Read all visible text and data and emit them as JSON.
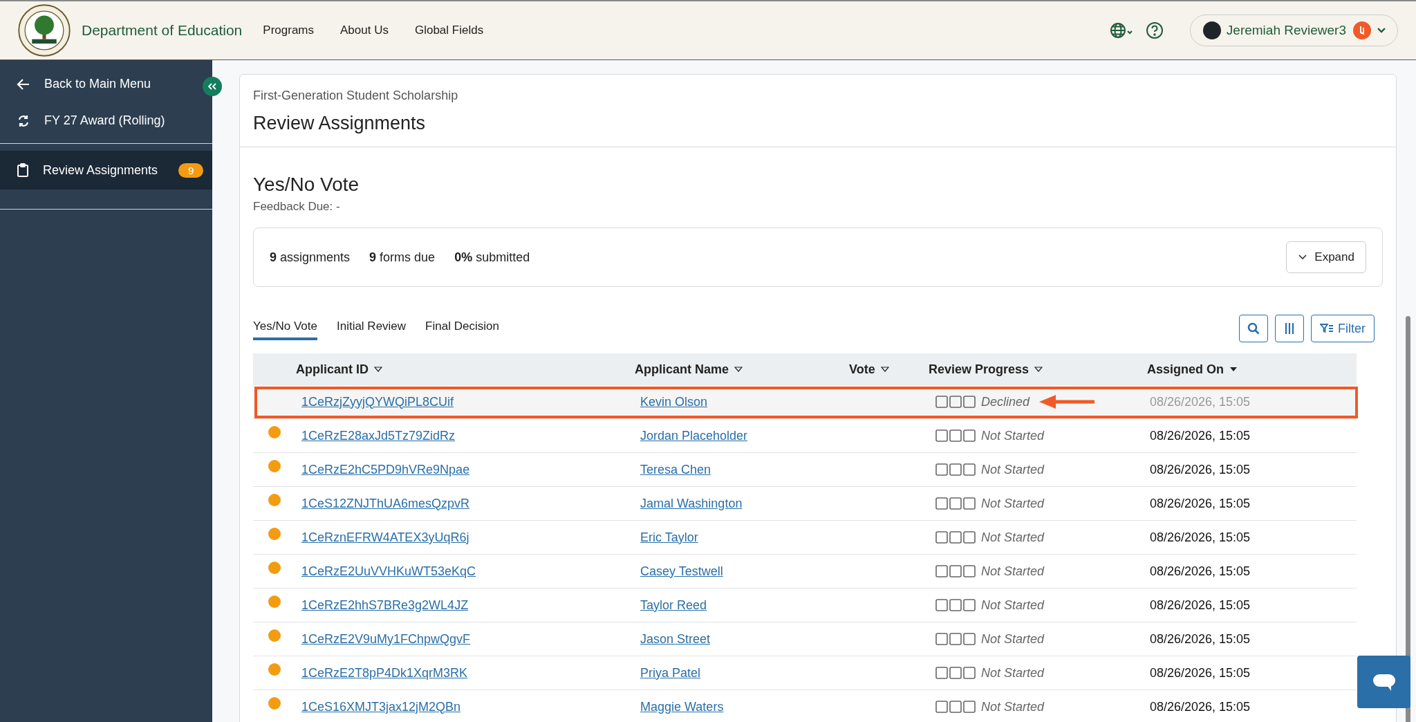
{
  "header": {
    "org_name": "Department of Education",
    "nav": [
      "Programs",
      "About Us",
      "Global Fields"
    ],
    "user_name": "Jeremiah Reviewer3"
  },
  "sidebar": {
    "items": [
      {
        "label": "Back to Main Menu",
        "kind": "back",
        "selected": false
      },
      {
        "label": "FY 27 Award (Rolling)",
        "kind": "cycle",
        "selected": false
      },
      {
        "label": "Review Assignments",
        "kind": "clipboard",
        "selected": true,
        "badge": "9"
      }
    ]
  },
  "page": {
    "program": "First-Generation Student Scholarship",
    "title": "Review Assignments"
  },
  "stage": {
    "title": "Yes/No Vote",
    "feedback_due": "Feedback Due: -",
    "stats": [
      "**9** assignments",
      "**9** forms due",
      "**0%** submitted"
    ],
    "expand_button": "Expand"
  },
  "tabs": [
    {
      "label": "Yes/No Vote",
      "selected": true
    },
    {
      "label": "Initial Review",
      "selected": false
    },
    {
      "label": "Final Decision",
      "selected": false
    }
  ],
  "filter_button": "Filter",
  "table": {
    "columns": [
      {
        "label": "Applicant ID",
        "sorted": false
      },
      {
        "label": "Applicant Name",
        "sorted": false
      },
      {
        "label": "Vote",
        "sorted": false
      },
      {
        "label": "Review Progress",
        "sorted": false
      },
      {
        "label": "Assigned On",
        "sorted": true
      }
    ],
    "rows": [
      {
        "dot": false,
        "highlighted": true,
        "id": "1CeRzjZyyjQYWQiPL8CUif",
        "name": "Kevin Olson",
        "status": "Declined",
        "assigned": "08/26/2026, 15:05"
      },
      {
        "dot": true,
        "highlighted": false,
        "id": "1CeRzE28axJd5Tz79ZidRz",
        "name": "Jordan Placeholder",
        "status": "Not Started",
        "assigned": "08/26/2026, 15:05"
      },
      {
        "dot": true,
        "highlighted": false,
        "id": "1CeRzE2hC5PD9hVRe9Npae",
        "name": "Teresa Chen",
        "status": "Not Started",
        "assigned": "08/26/2026, 15:05"
      },
      {
        "dot": true,
        "highlighted": false,
        "id": "1CeS12ZNJThUA6mesQzpvR",
        "name": "Jamal Washington",
        "status": "Not Started",
        "assigned": "08/26/2026, 15:05"
      },
      {
        "dot": true,
        "highlighted": false,
        "id": "1CeRznEFRW4ATEX3yUqR6j",
        "name": "Eric Taylor",
        "status": "Not Started",
        "assigned": "08/26/2026, 15:05"
      },
      {
        "dot": true,
        "highlighted": false,
        "id": "1CeRzE2UuVVHKuWT53eKqC",
        "name": "Casey Testwell",
        "status": "Not Started",
        "assigned": "08/26/2026, 15:05"
      },
      {
        "dot": true,
        "highlighted": false,
        "id": "1CeRzE2hhS7BRe3g2WL4JZ",
        "name": "Taylor Reed",
        "status": "Not Started",
        "assigned": "08/26/2026, 15:05"
      },
      {
        "dot": true,
        "highlighted": false,
        "id": "1CeRzE2V9uMy1FChpwQgvF",
        "name": "Jason Street",
        "status": "Not Started",
        "assigned": "08/26/2026, 15:05"
      },
      {
        "dot": true,
        "highlighted": false,
        "id": "1CeRzE2T8pP4Dk1XqrM3RK",
        "name": "Priya Patel",
        "status": "Not Started",
        "assigned": "08/26/2026, 15:05"
      },
      {
        "dot": true,
        "highlighted": false,
        "id": "1CeS16XMJT3jax12jM2QBn",
        "name": "Maggie Waters",
        "status": "Not Started",
        "assigned": "08/26/2026, 15:05"
      }
    ]
  }
}
